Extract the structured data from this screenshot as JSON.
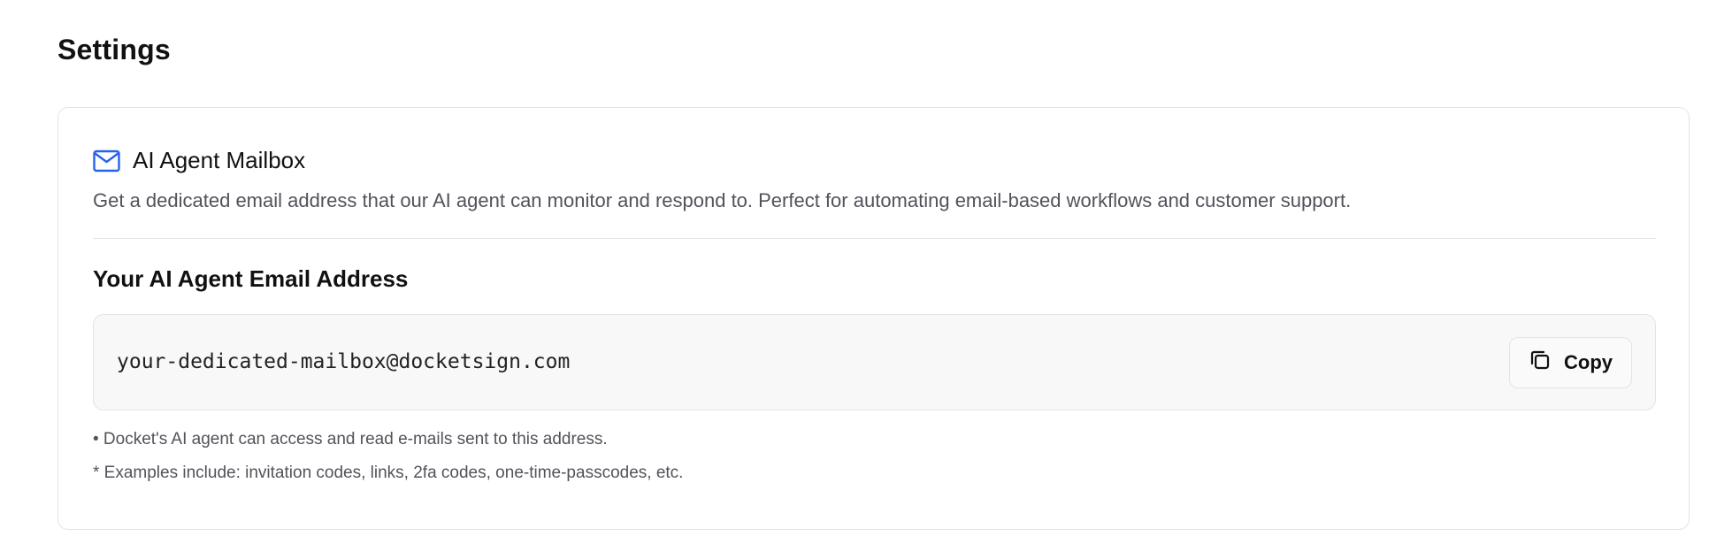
{
  "page": {
    "title": "Settings"
  },
  "mailbox_card": {
    "icon": "mail-icon",
    "title": "AI Agent Mailbox",
    "description": "Get a dedicated email address that our AI agent can monitor and respond to. Perfect for automating email-based workflows and customer support.",
    "section_title": "Your AI Agent Email Address",
    "email_address": "your-dedicated-mailbox@docketsign.com",
    "copy_button": {
      "icon": "copy-icon",
      "label": "Copy"
    },
    "notes": [
      "• Docket's AI agent can access and read e-mails sent to this address.",
      "* Examples include: invitation codes, links, 2fa codes, one-time-passcodes, etc."
    ]
  },
  "colors": {
    "accent": "#2563eb",
    "text_primary": "#111111",
    "text_muted": "#52525b",
    "border": "#e4e4e7",
    "email_box_bg": "#f8f8f8"
  }
}
